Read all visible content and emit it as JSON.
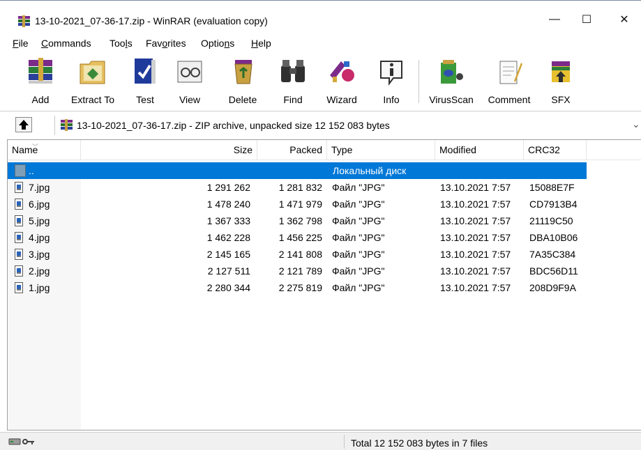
{
  "window": {
    "title": "13-10-2021_07-36-17.zip - WinRAR (evaluation copy)",
    "controls": {
      "minimize": "—",
      "maximize": "☐",
      "close": "✕"
    }
  },
  "menu": [
    {
      "pre": "",
      "u": "F",
      "post": "ile"
    },
    {
      "pre": "",
      "u": "C",
      "post": "ommands"
    },
    {
      "pre": "Too",
      "u": "l",
      "post": "s"
    },
    {
      "pre": "Fav",
      "u": "o",
      "post": "rites"
    },
    {
      "pre": "Optio",
      "u": "n",
      "post": "s"
    },
    {
      "pre": "",
      "u": "H",
      "post": "elp"
    }
  ],
  "toolbar": {
    "add": "Add",
    "extract_to": "Extract To",
    "test": "Test",
    "view": "View",
    "delete": "Delete",
    "find": "Find",
    "wizard": "Wizard",
    "info": "Info",
    "virusscan": "VirusScan",
    "comment": "Comment",
    "sfx": "SFX"
  },
  "address": {
    "text": "13-10-2021_07-36-17.zip - ZIP archive, unpacked size 12 152 083 bytes",
    "up_icon": "up-arrow-icon",
    "chevron": "⌄"
  },
  "columns": {
    "name": "Name",
    "size": "Size",
    "packed": "Packed",
    "type": "Type",
    "modified": "Modified",
    "crc": "CRC32"
  },
  "parent_row": {
    "name": "..",
    "type": "Локальный диск"
  },
  "files": [
    {
      "name": "7.jpg",
      "size": "1 291 262",
      "packed": "1 281 832",
      "type": "Файл \"JPG\"",
      "modified": "13.10.2021 7:57",
      "crc": "15088E7F"
    },
    {
      "name": "6.jpg",
      "size": "1 478 240",
      "packed": "1 471 979",
      "type": "Файл \"JPG\"",
      "modified": "13.10.2021 7:57",
      "crc": "CD7913B4"
    },
    {
      "name": "5.jpg",
      "size": "1 367 333",
      "packed": "1 362 798",
      "type": "Файл \"JPG\"",
      "modified": "13.10.2021 7:57",
      "crc": "21119C50"
    },
    {
      "name": "4.jpg",
      "size": "1 462 228",
      "packed": "1 456 225",
      "type": "Файл \"JPG\"",
      "modified": "13.10.2021 7:57",
      "crc": "DBA10B06"
    },
    {
      "name": "3.jpg",
      "size": "2 145 165",
      "packed": "2 141 808",
      "type": "Файл \"JPG\"",
      "modified": "13.10.2021 7:57",
      "crc": "7A35C384"
    },
    {
      "name": "2.jpg",
      "size": "2 127 511",
      "packed": "2 121 789",
      "type": "Файл \"JPG\"",
      "modified": "13.10.2021 7:57",
      "crc": "BDC56D11"
    },
    {
      "name": "1.jpg",
      "size": "2 280 344",
      "packed": "2 275 819",
      "type": "Файл \"JPG\"",
      "modified": "13.10.2021 7:57",
      "crc": "208D9F9A"
    }
  ],
  "status": {
    "text": "Total 12 152 083 bytes in 7 files"
  },
  "colors": {
    "selection": "#0078d7",
    "window_bg": "#ffffff",
    "status_bg": "#f0f0f0"
  }
}
